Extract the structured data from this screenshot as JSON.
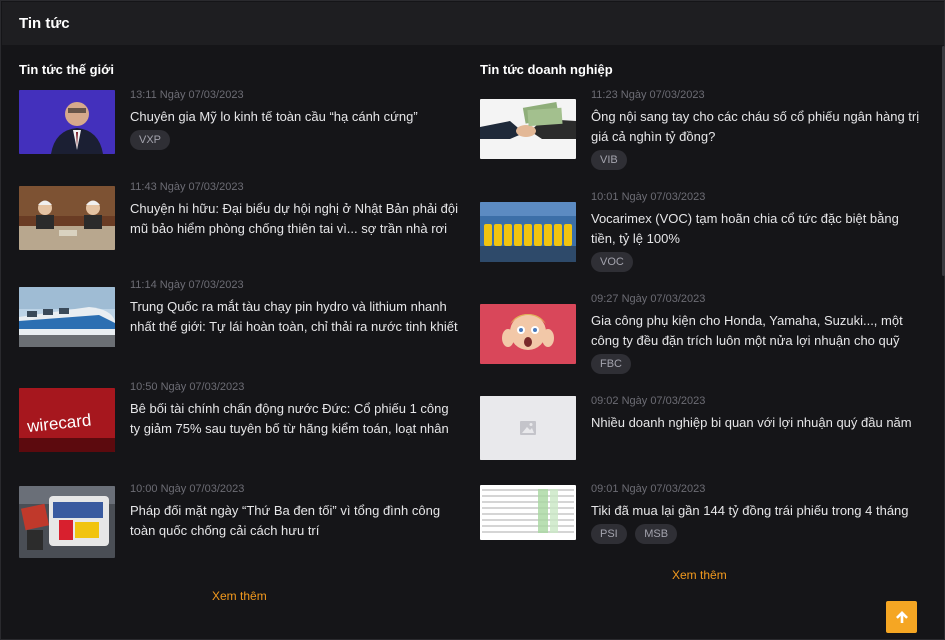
{
  "header": {
    "title": "Tin tức"
  },
  "world": {
    "title": "Tin tức thế giới",
    "more_label": "Xem thêm",
    "items": [
      {
        "time": "13:11 Ngày 07/03/2023",
        "headline": "Chuyên gia Mỹ lo kinh tế toàn cầu “hạ cánh cứng”",
        "tags": [
          "VXP"
        ]
      },
      {
        "time": "11:43 Ngày 07/03/2023",
        "headline": "Chuyện hi hữu: Đại biểu dự hội nghị ở Nhật Bản phải đội mũ bảo hiểm phòng chống thiên tai vì... sợ trần nhà rơi vào đầu",
        "tags": []
      },
      {
        "time": "11:14 Ngày 07/03/2023",
        "headline": "Trung Quốc ra mắt tàu chạy pin hydro và lithium nhanh nhất thế giới: Tự lái hoàn toàn, chỉ thải ra nước tinh khiết v...",
        "tags": []
      },
      {
        "time": "10:50 Ngày 07/03/2023",
        "headline": "Bê bối tài chính chấn động nước Đức: Cổ phiếu 1 công ty giảm 75% sau tuyên bố từ hãng kiểm toán, loạt nhân chứ...",
        "tags": []
      },
      {
        "time": "10:00 Ngày 07/03/2023",
        "headline": "Pháp đối mặt ngày “Thứ Ba đen tối” vì tổng đình công toàn quốc chống cải cách hưu trí",
        "tags": []
      }
    ]
  },
  "business": {
    "title": "Tin tức doanh nghiệp",
    "more_label": "Xem thêm",
    "items": [
      {
        "time": "11:23 Ngày 07/03/2023",
        "headline": "Ông nội sang tay cho các cháu số cổ phiếu ngân hàng trị giá cả nghìn tỷ đồng?",
        "tags": [
          "VIB"
        ]
      },
      {
        "time": "10:01 Ngày 07/03/2023",
        "headline": "Vocarimex (VOC) tạm hoãn chia cổ tức đặc biệt bằng tiền, tỷ lệ 100%",
        "tags": [
          "VOC"
        ]
      },
      {
        "time": "09:27 Ngày 07/03/2023",
        "headline": "Gia công phụ kiện cho Honda, Yamaha, Suzuki..., một công ty đều đặn trích luôn một nửa lợi nhuận cho quỹ khen...",
        "tags": [
          "FBC"
        ]
      },
      {
        "time": "09:02 Ngày 07/03/2023",
        "headline": "Nhiều doanh nghiệp bi quan với lợi nhuận quý đầu năm",
        "tags": []
      },
      {
        "time": "09:01 Ngày 07/03/2023",
        "headline": "Tiki đã mua lại gần 144 tỷ đồng trái phiếu trong 4 tháng",
        "tags": [
          "PSI",
          "MSB"
        ]
      }
    ]
  },
  "thumb_wirecard_text": "wirecard",
  "colors": {
    "accent": "#f39a1e",
    "scroll_top_bg": "#f5a623",
    "tag_bg": "#2f2f35"
  },
  "icons": {
    "scroll_top": "arrow-up-icon",
    "placeholder": "image-placeholder-icon"
  }
}
